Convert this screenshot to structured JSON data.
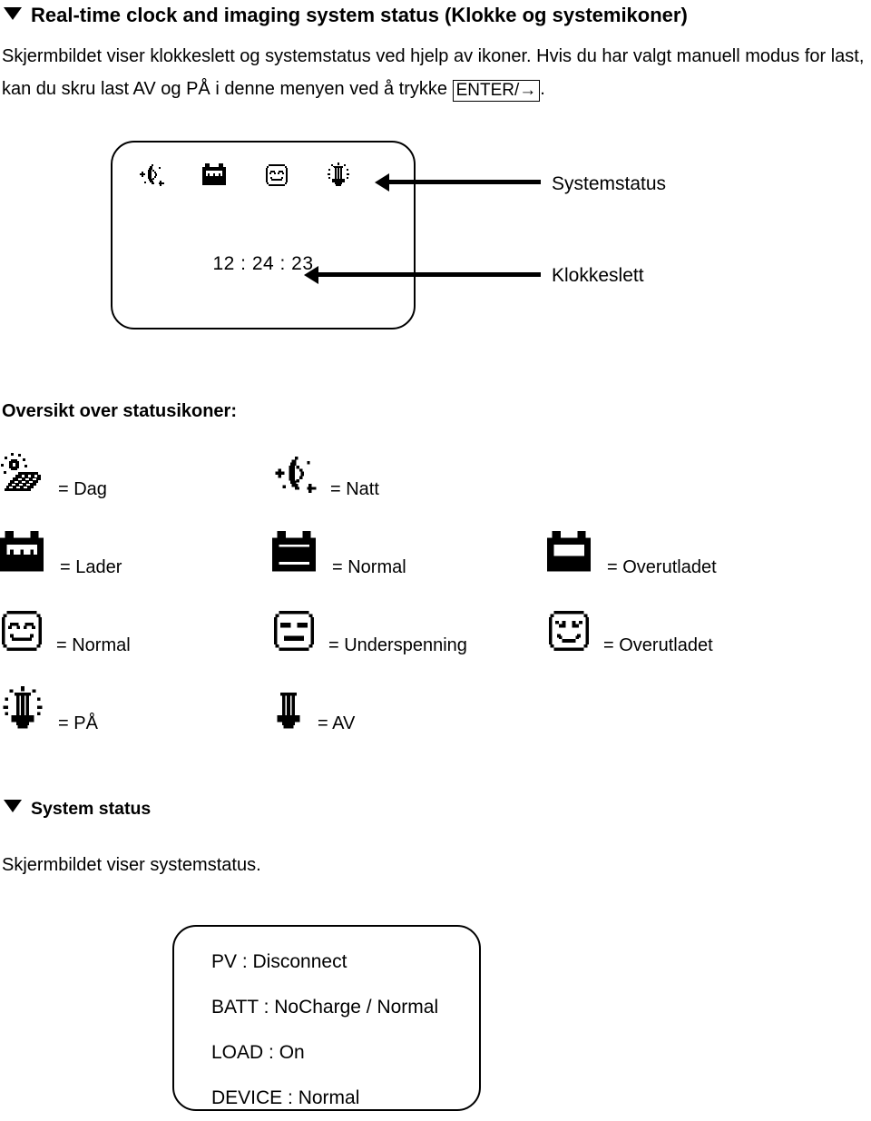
{
  "sections": {
    "clock": {
      "heading": "Real-time clock and imaging system status (Klokke og systemikoner)",
      "para_before_key": "Skjermbildet viser klokkeslett og systemstatus ved hjelp av ikoner. Hvis du har valgt manuell modus for last, kan du skru last AV og PÅ i denne menyen ved å trykke ",
      "keycap": "ENTER/→",
      "para_after_key": "."
    },
    "system_status": {
      "heading": "System status",
      "para": "Skjermbildet viser systemstatus."
    }
  },
  "lcd_clock": {
    "icons": [
      "night-moon-icon",
      "battery-charging-icon",
      "face-normal-icon",
      "bulb-on-icon"
    ],
    "time": "12 : 24 : 23",
    "callouts": [
      {
        "label": "Systemstatus",
        "target": "status-icon-row"
      },
      {
        "label": "Klokkeslett",
        "target": "clock-time"
      }
    ]
  },
  "icon_legend": {
    "title": "Oversikt over statusikoner:",
    "rows": [
      [
        {
          "icon": "day-solar-panel-icon",
          "label": "= Dag"
        },
        {
          "icon": "night-moon-icon",
          "label": "= Natt"
        }
      ],
      [
        {
          "icon": "battery-charging-icon",
          "label": "= Lader"
        },
        {
          "icon": "battery-full-icon",
          "label": "= Normal"
        },
        {
          "icon": "battery-low-icon",
          "label": "= Overutladet"
        }
      ],
      [
        {
          "icon": "face-happy-icon",
          "label": "= Normal"
        },
        {
          "icon": "face-neutral-icon",
          "label": "= Underspenning"
        },
        {
          "icon": "face-sad-icon",
          "label": "= Overutladet"
        }
      ],
      [
        {
          "icon": "bulb-on-icon",
          "label": "= PÅ"
        },
        {
          "icon": "bulb-off-icon",
          "label": "= AV"
        }
      ]
    ]
  },
  "lcd_system": {
    "lines": [
      "PV : Disconnect",
      "BATT : NoCharge / Normal",
      "LOAD : On",
      "DEVICE : Normal"
    ]
  },
  "colors": {
    "ink": "#000000",
    "page": "#ffffff"
  }
}
